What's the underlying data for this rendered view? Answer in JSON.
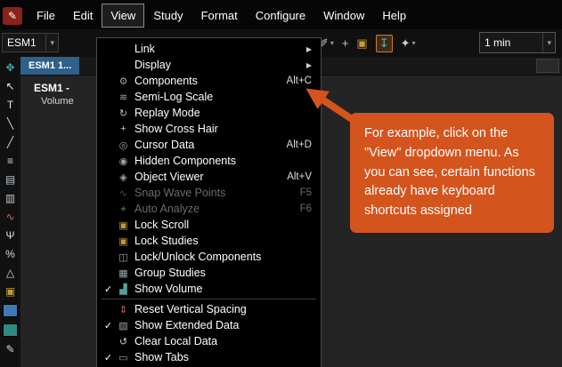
{
  "colors": {
    "accent_orange": "#d4541d",
    "tab_blue": "#2e6089"
  },
  "menubar": {
    "items": [
      {
        "label": "File"
      },
      {
        "label": "Edit"
      },
      {
        "label": "View",
        "active": true
      },
      {
        "label": "Study"
      },
      {
        "label": "Format"
      },
      {
        "label": "Configure"
      },
      {
        "label": "Window"
      },
      {
        "label": "Help"
      }
    ]
  },
  "toolbar": {
    "symbol_combo": {
      "value": "ESM1"
    },
    "interval_combo": {
      "value": "1 min"
    },
    "right_icons": [
      {
        "name": "zoom-out-button",
        "icon": "zoom-out-icon"
      },
      {
        "name": "cursor-style-button",
        "icon": "marker-pen-icon",
        "caret": true
      },
      {
        "name": "add-crosshair-button",
        "icon": "plus-icon"
      },
      {
        "name": "lock-button",
        "icon": "lock-icon"
      },
      {
        "name": "extended-data-toggle",
        "icon": "down-arrow-tray-icon",
        "active": true
      },
      {
        "name": "auto-tool-button",
        "icon": "sparkle-icon",
        "caret": true
      }
    ]
  },
  "left_toolbar": {
    "tools": [
      {
        "name": "pan-tool-icon"
      },
      {
        "name": "cursor-tool-icon"
      },
      {
        "name": "text-tool-icon"
      },
      {
        "name": "trendline-tool-icon"
      },
      {
        "name": "ray-tool-icon"
      },
      {
        "name": "lines-tool-icon"
      },
      {
        "name": "fib-retracement-tool-icon"
      },
      {
        "name": "fib-extension-tool-icon"
      },
      {
        "name": "wave-tool-icon"
      },
      {
        "name": "pitchfork-tool-icon"
      },
      {
        "name": "percent-tool-icon"
      },
      {
        "name": "pattern-tool-icon"
      },
      {
        "name": "lock-tool-icon"
      },
      {
        "name": "color-swatch-blue",
        "swatch": "#3d7ab5"
      },
      {
        "name": "color-swatch-teal",
        "swatch": "#2e8b84"
      },
      {
        "name": "pencil-tool-icon"
      }
    ]
  },
  "chart": {
    "tab_label": "ESM1 1...",
    "title": "ESM1 -",
    "subtitle": "Volume"
  },
  "view_menu": {
    "items": [
      {
        "label": "Link",
        "submenu": true
      },
      {
        "label": "Display",
        "submenu": true
      },
      {
        "label": "Components",
        "icon": "components-icon",
        "shortcut": "Alt+C"
      },
      {
        "label": "Semi-Log Scale",
        "icon": "semi-log-icon"
      },
      {
        "label": "Replay Mode",
        "icon": "replay-icon"
      },
      {
        "label": "Show Cross Hair",
        "icon": "crosshair-icon"
      },
      {
        "label": "Cursor Data",
        "icon": "cursor-data-icon",
        "shortcut": "Alt+D"
      },
      {
        "label": "Hidden Components",
        "icon": "hidden-components-icon"
      },
      {
        "label": "Object Viewer",
        "icon": "object-viewer-icon",
        "shortcut": "Alt+V"
      },
      {
        "label": "Snap Wave Points",
        "icon": "snap-wave-icon",
        "shortcut": "F5",
        "disabled": true
      },
      {
        "label": "Auto Analyze",
        "icon": "auto-analyze-icon",
        "shortcut": "F6",
        "disabled": true
      },
      {
        "label": "Lock Scroll",
        "icon": "lock-scroll-icon"
      },
      {
        "label": "Lock Studies",
        "icon": "lock-studies-icon"
      },
      {
        "label": "Lock/Unlock Components",
        "icon": "lock-unlock-icon"
      },
      {
        "label": "Group Studies",
        "icon": "group-studies-icon"
      },
      {
        "label": "Show Volume",
        "icon": "show-volume-icon",
        "checked": true
      },
      {
        "separator": true
      },
      {
        "label": "Reset Vertical Spacing",
        "icon": "reset-spacing-icon"
      },
      {
        "label": "Show Extended Data",
        "icon": "extended-data-icon",
        "checked": true
      },
      {
        "label": "Clear Local Data",
        "icon": "clear-data-icon"
      },
      {
        "label": "Show Tabs",
        "icon": "show-tabs-icon",
        "checked": true
      }
    ]
  },
  "callout": {
    "text": "For example, click on the \"View\" dropdown menu.  As you can see, certain functions already have keyboard shortcuts assigned"
  }
}
